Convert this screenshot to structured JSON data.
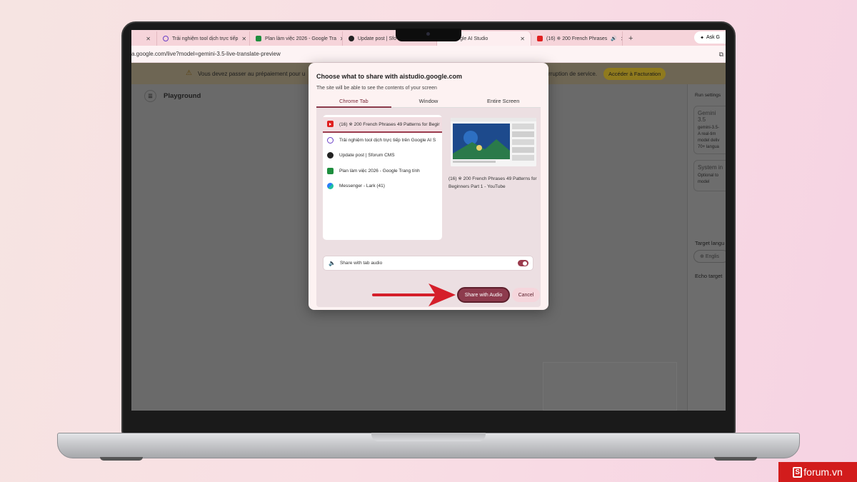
{
  "browser": {
    "tabs": [
      {
        "label": "",
        "icon": "close-icon",
        "color": "#444444"
      },
      {
        "label": "Trải nghiệm tool dịch trực tiếp",
        "icon": "at-icon",
        "color": "#6a3fc7"
      },
      {
        "label": "Plan làm việc 2026 - Google Tra",
        "icon": "sheets-icon",
        "color": "#1e8e3e"
      },
      {
        "label": "Update post | Sfo",
        "icon": "github-icon",
        "color": "#222222"
      },
      {
        "label": "Google AI Studio",
        "icon": "aistudio-icon",
        "color": "#333333"
      },
      {
        "label": "(16) ※ 200 French Phrases",
        "icon": "youtube-icon",
        "color": "#e02020"
      }
    ],
    "new_tab": "+",
    "ask_label": "Ask G",
    "url": "a.google.com/live?model=gemini-3.5-live-translate-preview"
  },
  "page": {
    "warning_text": "Vous devez passer au prépaiement pour u",
    "warning_text_right": "rruption de service.",
    "billing_button": "Accéder à Facturation",
    "playground_title": "Playground",
    "run_settings": "Run settings",
    "model_card": {
      "title": "Gemini 3.5",
      "lines": [
        "gemini-3.5-",
        "A real-tim",
        "model deliv",
        "70+ langua"
      ]
    },
    "system_card": {
      "title": "System in",
      "lines": [
        "Optional to",
        "model"
      ]
    },
    "target_language_label": "Target langu",
    "target_language_value": "Englis",
    "echo_label": "Echo target"
  },
  "dialog": {
    "title": "Choose what to share with aistudio.google.com",
    "subtitle": "The site will be able to see the contents of your screen",
    "tabs": [
      "Chrome Tab",
      "Window",
      "Entire Screen"
    ],
    "active_tab": "Chrome Tab",
    "tab_list": [
      {
        "label": "(16) ※ 200 French Phrases 49 Patterns for Begir",
        "icon": "youtube-icon",
        "selected": true
      },
      {
        "label": "Trải nghiệm tool dịch trực tiếp trên Google AI S",
        "icon": "at-icon",
        "selected": false
      },
      {
        "label": "Update post | Sforum CMS",
        "icon": "github-icon",
        "selected": false
      },
      {
        "label": "Plan làm việc 2026 - Google Trang tính",
        "icon": "sheets-icon",
        "selected": false
      },
      {
        "label": "Messenger - Lark (41)",
        "icon": "lark-icon",
        "selected": false
      }
    ],
    "preview_caption": "(16) ※ 200 French Phrases 49 Patterns for Beginners Part 1 - YouTube",
    "audio_label": "Share with tab audio",
    "audio_enabled": true,
    "share_button": "Share with Audio",
    "cancel_button": "Cancel"
  },
  "watermark": {
    "letter": "S",
    "text": "forum.vn"
  }
}
